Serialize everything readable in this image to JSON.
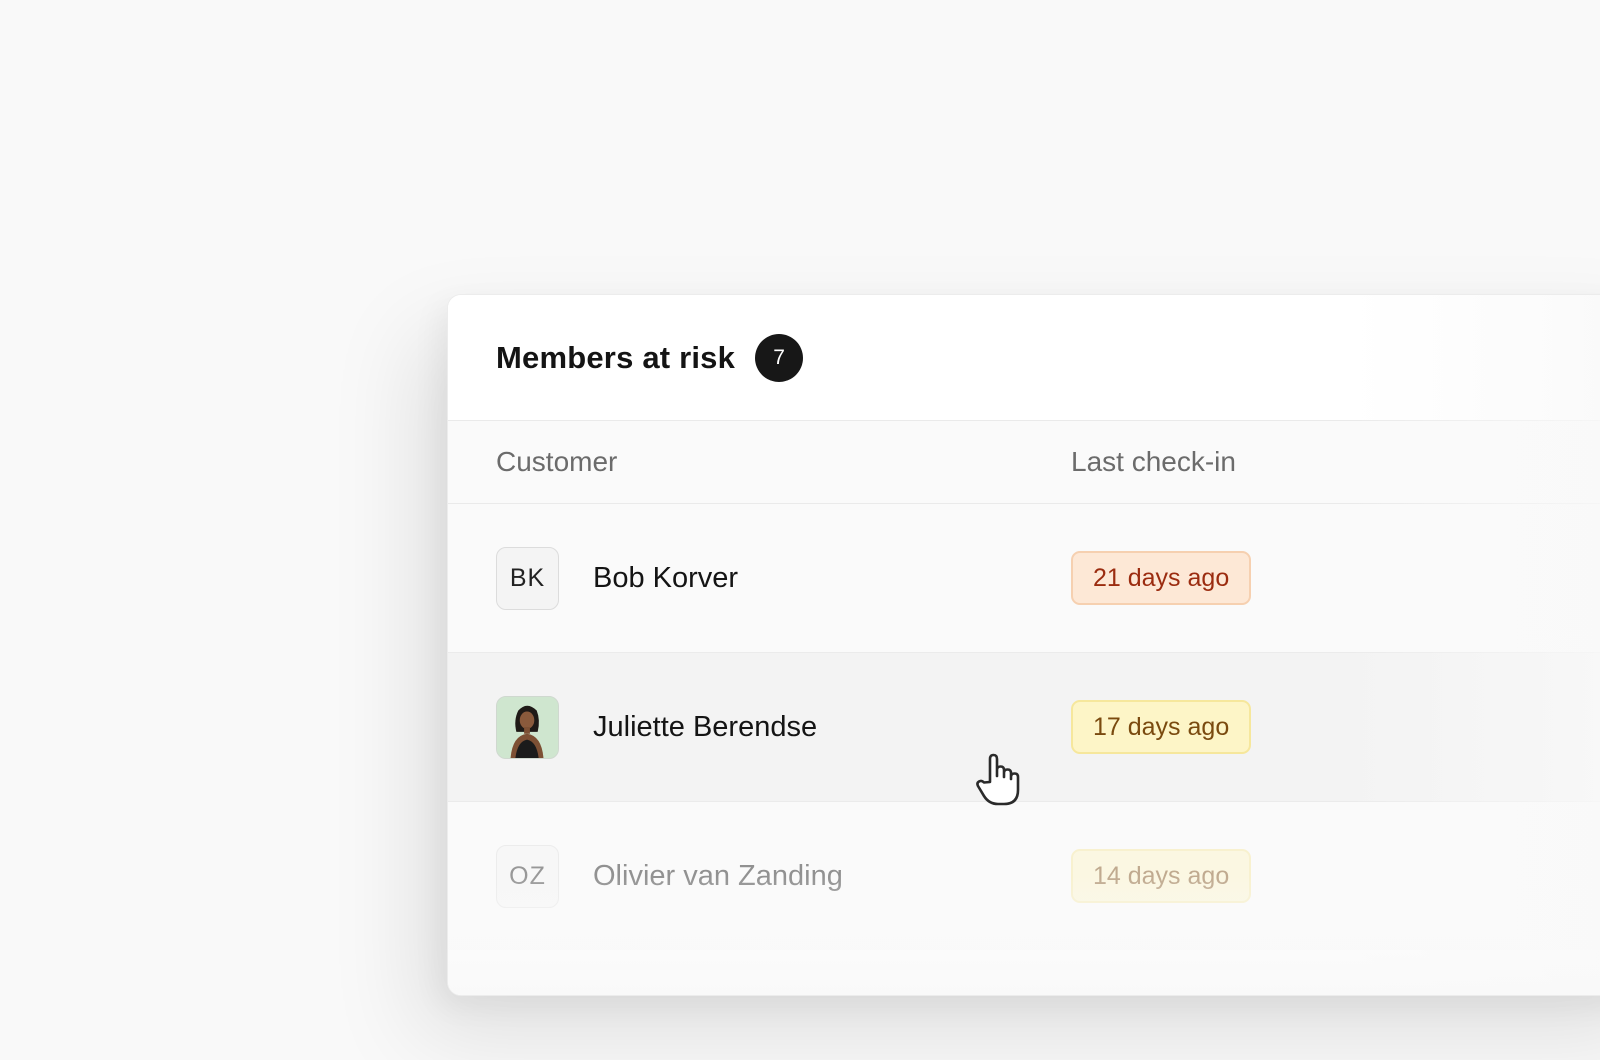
{
  "panel": {
    "title": "Members at risk",
    "count": "7"
  },
  "table": {
    "columns": {
      "customer": "Customer",
      "last_checkin": "Last check-in"
    },
    "rows": [
      {
        "initials": "BK",
        "name": "Bob Korver",
        "last_checkin": "21 days ago",
        "severity": "high",
        "severity_color": "#fde8d6"
      },
      {
        "initials": "",
        "name": "Juliette Berendse",
        "last_checkin": "17 days ago",
        "severity": "medium",
        "severity_color": "#fdf5c7",
        "avatar_type": "photo"
      },
      {
        "initials": "OZ",
        "name": "Olivier van Zanding",
        "last_checkin": "14 days ago",
        "severity": "medium",
        "severity_color": "#fdf5c7"
      }
    ]
  },
  "cursor_icon": "hand-pointer-icon"
}
